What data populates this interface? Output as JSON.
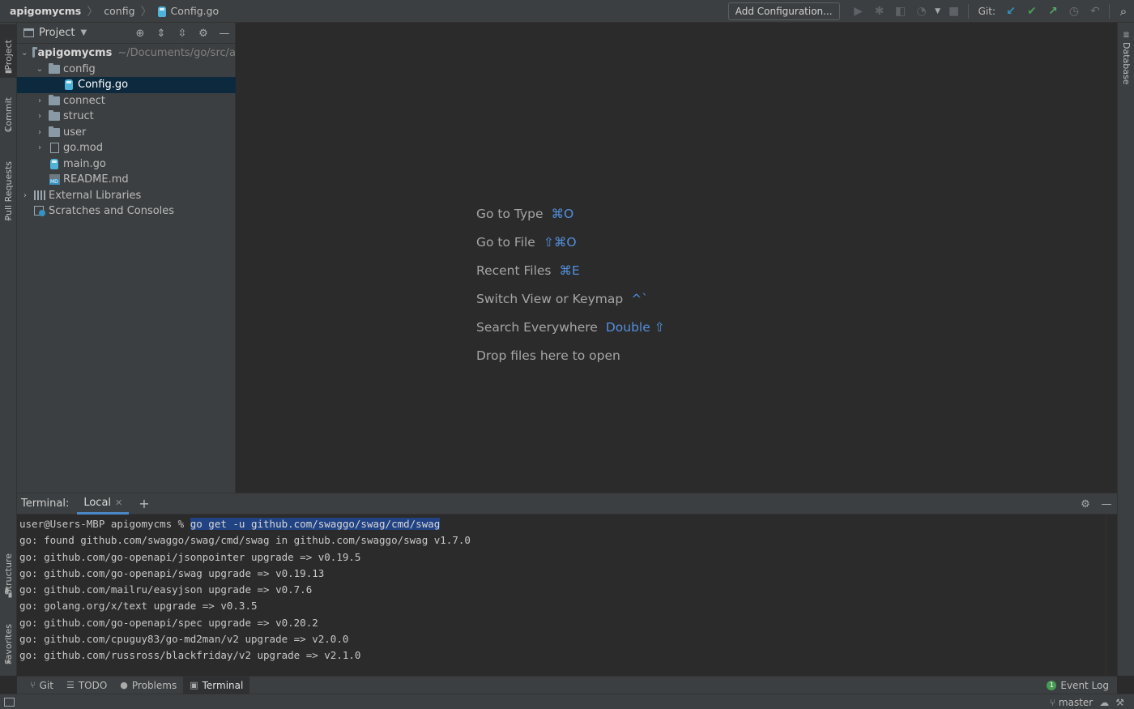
{
  "breadcrumbs": [
    {
      "label": "apigomycms"
    },
    {
      "label": "config"
    },
    {
      "label": "Config.go"
    }
  ],
  "toolbar": {
    "add_configuration": "Add Configuration...",
    "git_label": "Git:"
  },
  "left_tabs": {
    "project": "Project",
    "commit": "Commit",
    "pull_requests": "Pull Requests",
    "structure": "Structure",
    "favorites": "Favorites"
  },
  "right_tabs": {
    "database": "Database"
  },
  "project_panel": {
    "title": "Project",
    "root": {
      "name": "apigomycms",
      "path": "~/Documents/go/src/a"
    },
    "items": [
      {
        "label": "config"
      },
      {
        "label": "Config.go"
      },
      {
        "label": "connect"
      },
      {
        "label": "struct"
      },
      {
        "label": "user"
      },
      {
        "label": "go.mod"
      },
      {
        "label": "main.go"
      },
      {
        "label": "README.md"
      },
      {
        "label": "External Libraries"
      },
      {
        "label": "Scratches and Consoles"
      }
    ]
  },
  "editor_hints": [
    {
      "label": "Go to Type",
      "shortcut": "⌘O"
    },
    {
      "label": "Go to File",
      "shortcut": "⇧⌘O"
    },
    {
      "label": "Recent Files",
      "shortcut": "⌘E"
    },
    {
      "label": "Switch View or Keymap",
      "shortcut": "^`"
    },
    {
      "label": "Search Everywhere",
      "shortcut": "Double ⇧"
    },
    {
      "label": "Drop files here to open",
      "shortcut": ""
    }
  ],
  "terminal": {
    "title": "Terminal:",
    "tab": "Local",
    "prompt": "user@Users-MBP apigomycms % ",
    "command": "go get -u github.com/swaggo/swag/cmd/swag",
    "output": [
      "go: found github.com/swaggo/swag/cmd/swag in github.com/swaggo/swag v1.7.0",
      "go: github.com/go-openapi/jsonpointer upgrade => v0.19.5",
      "go: github.com/go-openapi/swag upgrade => v0.19.13",
      "go: github.com/mailru/easyjson upgrade => v0.7.6",
      "go: golang.org/x/text upgrade => v0.3.5",
      "go: github.com/go-openapi/spec upgrade => v0.20.2",
      "go: github.com/cpuguy83/go-md2man/v2 upgrade => v2.0.0",
      "go: github.com/russross/blackfriday/v2 upgrade => v2.1.0"
    ]
  },
  "bottom_tabs": [
    {
      "label": "Git"
    },
    {
      "label": "TODO"
    },
    {
      "label": "Problems"
    },
    {
      "label": "Terminal"
    }
  ],
  "event_log": {
    "label": "Event Log",
    "count": "1"
  },
  "status": {
    "branch": "master"
  },
  "colors": {
    "accent": "#4a88c7",
    "selection": "#0d293e",
    "command_highlight": "#214283",
    "shortcut": "#589df6",
    "git_update": "#3592c4",
    "git_commit": "#499c54",
    "git_push": "#59a869"
  }
}
